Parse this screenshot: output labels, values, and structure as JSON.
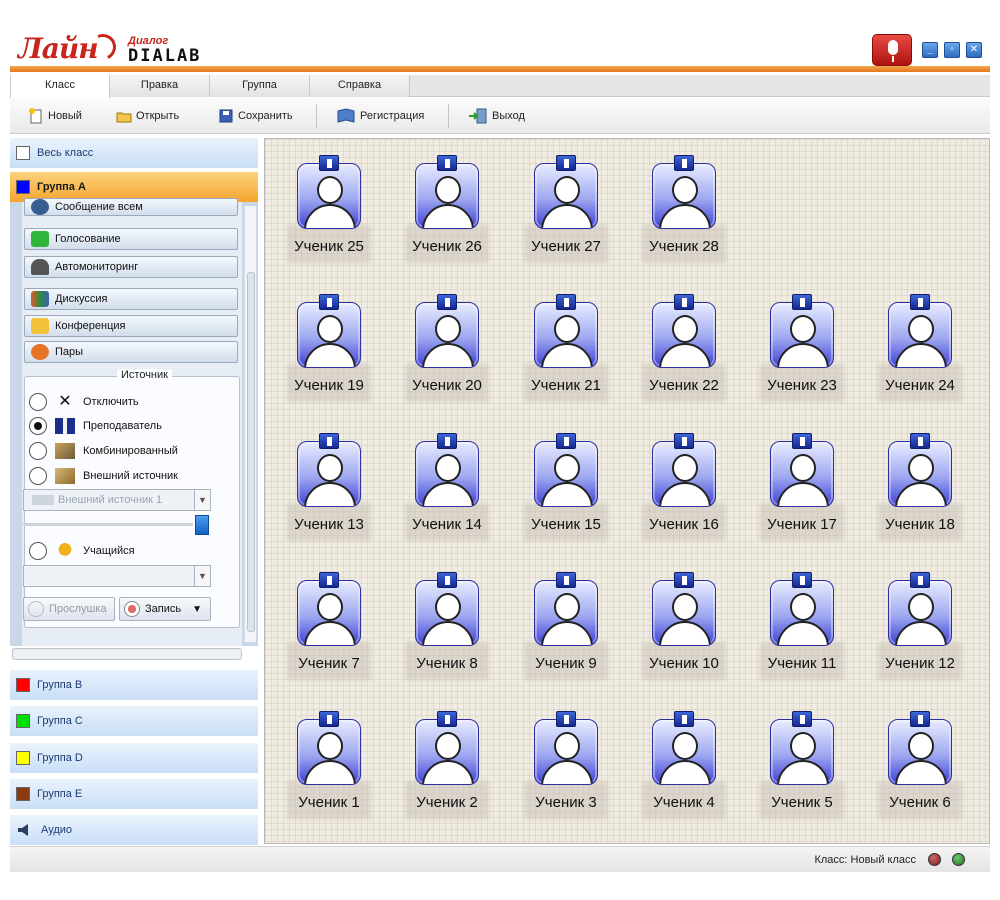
{
  "logo": {
    "brand": "Лайн",
    "product_top": "Диалог",
    "product_bottom": "DIALAB"
  },
  "colors": {
    "accent_orange": "#f19b3a",
    "group_a": "#0000ff",
    "group_b": "#ff0000",
    "group_c": "#00e000",
    "group_d": "#ffff00",
    "group_e": "#8b3a10",
    "student_card": "#3e3fd4"
  },
  "menu": {
    "tabs": [
      "Класс",
      "Правка",
      "Группа",
      "Справка"
    ],
    "active": "Класс"
  },
  "toolbar": {
    "new": "Новый",
    "open": "Открыть",
    "save": "Сохранить",
    "register": "Регистрация",
    "exit": "Выход"
  },
  "left": {
    "whole_class": "Весь класс",
    "group_a": "Группа A",
    "actions": [
      "Сообщение всем",
      "Голосование",
      "Автомониторинг",
      "Дискуссия",
      "Конференция",
      "Пары"
    ],
    "source": {
      "legend": "Источник",
      "options": [
        "Отключить",
        "Преподаватель",
        "Комбинированный",
        "Внешний источник"
      ],
      "selected": "Преподаватель",
      "external_select": "Внешний источник 1",
      "student_option": "Учащийся",
      "student_select": "",
      "listen": "Прослушка",
      "record": "Запись"
    },
    "groups": [
      "Группа B",
      "Группа C",
      "Группа D",
      "Группа E"
    ],
    "audio": "Аудио"
  },
  "students": {
    "rows": [
      [
        "Ученик 25",
        "Ученик 26",
        "Ученик 27",
        "Ученик 28"
      ],
      [
        "Ученик 19",
        "Ученик 20",
        "Ученик 21",
        "Ученик 22",
        "Ученик 23",
        "Ученик 24"
      ],
      [
        "Ученик 13",
        "Ученик 14",
        "Ученик 15",
        "Ученик 16",
        "Ученик 17",
        "Ученик 18"
      ],
      [
        "Ученик 7",
        "Ученик 8",
        "Ученик 9",
        "Ученик 10",
        "Ученик 11",
        "Ученик 12"
      ],
      [
        "Ученик 1",
        "Ученик 2",
        "Ученик 3",
        "Ученик 4",
        "Ученик 5",
        "Ученик 6"
      ]
    ]
  },
  "status": {
    "class_label": "Класс: Новый класс"
  }
}
